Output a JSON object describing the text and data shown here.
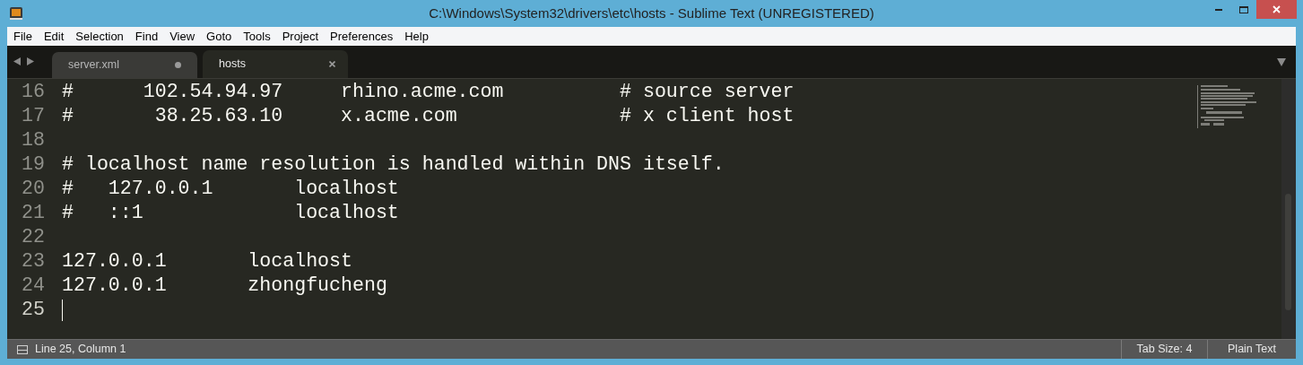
{
  "window": {
    "title": "C:\\Windows\\System32\\drivers\\etc\\hosts - Sublime Text (UNREGISTERED)"
  },
  "menu": [
    "File",
    "Edit",
    "Selection",
    "Find",
    "View",
    "Goto",
    "Tools",
    "Project",
    "Preferences",
    "Help"
  ],
  "tabs": [
    {
      "label": "server.xml",
      "selected": false,
      "modified": true
    },
    {
      "label": "hosts",
      "selected": true,
      "modified": false
    }
  ],
  "lines": [
    {
      "number": "16",
      "text": "#      102.54.94.97     rhino.acme.com          # source server",
      "current": false
    },
    {
      "number": "17",
      "text": "#       38.25.63.10     x.acme.com              # x client host",
      "current": false
    },
    {
      "number": "18",
      "current": false
    },
    {
      "number": "19",
      "text": "# localhost name resolution is handled within DNS itself.",
      "current": false
    },
    {
      "number": "20",
      "text": "#   127.0.0.1       localhost",
      "current": false
    },
    {
      "number": "21",
      "text": "#   ::1             localhost",
      "current": false
    },
    {
      "number": "22",
      "current": false
    },
    {
      "number": "23",
      "text": "127.0.0.1       localhost",
      "current": false
    },
    {
      "number": "24",
      "text": "127.0.0.1       zhongfucheng",
      "current": false
    },
    {
      "number": "25",
      "current": true
    }
  ],
  "status_bar": {
    "position": "Line 25, Column 1",
    "tab_size": "Tab Size: 4",
    "syntax": "Plain Text"
  }
}
